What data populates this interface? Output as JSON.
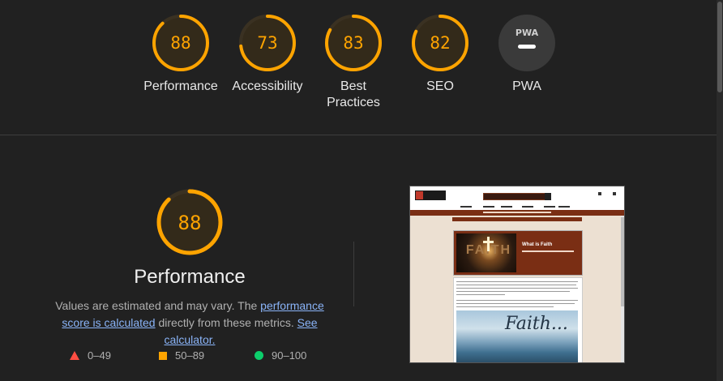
{
  "categories": [
    {
      "label": "Performance",
      "score": "88",
      "value": 88
    },
    {
      "label": "Accessibility",
      "score": "73",
      "value": 73
    },
    {
      "label": "Best Practices",
      "score": "83",
      "value": 83
    },
    {
      "label": "SEO",
      "score": "82",
      "value": 82
    },
    {
      "label": "PWA",
      "badge": "PWA",
      "value": null
    }
  ],
  "performance": {
    "score": "88",
    "value": 88,
    "title": "Performance",
    "desc_prefix": "Values are estimated and may vary. The ",
    "score_link": "performance score is calculated",
    "desc_middle": " directly from these metrics. ",
    "calc_link": "See calculator."
  },
  "legend": [
    {
      "range": "0–49",
      "shape": "triangle",
      "color": "#ff4e42"
    },
    {
      "range": "50–89",
      "shape": "square",
      "color": "#ffa400"
    },
    {
      "range": "90–100",
      "shape": "circle",
      "color": "#0cce6b"
    }
  ],
  "colors": {
    "average": "#ffa400",
    "gauge_track": "#3a3122",
    "gauge_fill_bg": "#332a1a",
    "pwa_bg": "#3a3a3a",
    "link": "#8ab4f8"
  },
  "screenshot": {
    "hero_title": "What is Faith",
    "hero_word": "FAITH",
    "image_script": "Faith..."
  }
}
